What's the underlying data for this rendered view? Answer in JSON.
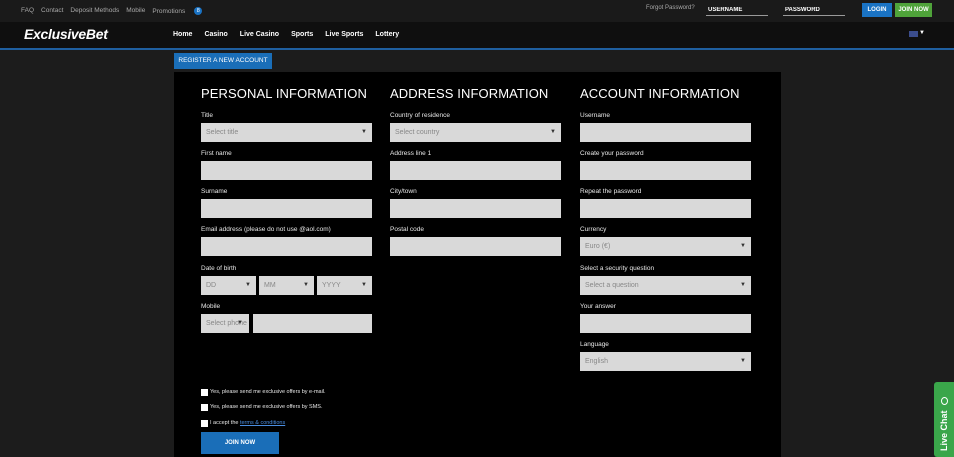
{
  "topbar": {
    "links": [
      "FAQ",
      "Contact",
      "Deposit Methods",
      "Mobile",
      "Promotions"
    ],
    "promotions_badge": "8",
    "forgot_password": "Forgot Password?",
    "username_placeholder": "USERNAME",
    "password_placeholder": "PASSWORD",
    "login_label": "LOGIN",
    "join_label": "JOIN NOW"
  },
  "nav": {
    "logo": "ExclusiveBet",
    "items": [
      "Home",
      "Casino",
      "Live Casino",
      "Sports",
      "Live Sports",
      "Lottery"
    ]
  },
  "register_tab": "REGISTER A NEW ACCOUNT",
  "personal": {
    "title": "PERSONAL INFORMATION",
    "title_label": "Title",
    "title_select": "Select title",
    "firstname_label": "First name",
    "surname_label": "Surname",
    "email_label": "Email address (please do not use @aol.com)",
    "dob_label": "Date of birth",
    "dob_day": "DD",
    "dob_month": "MM",
    "dob_year": "YYYY",
    "mobile_label": "Mobile",
    "mobile_prefix": "Select phone"
  },
  "address": {
    "title": "ADDRESS INFORMATION",
    "country_label": "Country of residence",
    "country_select": "Select country",
    "address_label": "Address line 1",
    "city_label": "City/town",
    "postal_label": "Postal code"
  },
  "account": {
    "title": "ACCOUNT INFORMATION",
    "username_label": "Username",
    "password_label": "Create your password",
    "repeat_label": "Repeat the password",
    "currency_label": "Currency",
    "currency_select": "Euro (€)",
    "question_label": "Select a security question",
    "question_select": "Select a question",
    "answer_label": "Your answer",
    "language_label": "Language",
    "language_select": "English"
  },
  "consents": {
    "email_offers": "Yes, please send me exclusive offers by e-mail.",
    "sms_offers": "Yes, please send me exclusive offers by SMS.",
    "accept_prefix": "I accept the",
    "terms_link": "terms & conditions"
  },
  "join_button": "JOIN NOW",
  "live_chat": "Live Chat",
  "colors": {
    "accent_blue": "#1a6eb8",
    "join_green": "#4fa33a",
    "chat_green": "#3aa64a",
    "field_bg": "#d9d9d9"
  }
}
